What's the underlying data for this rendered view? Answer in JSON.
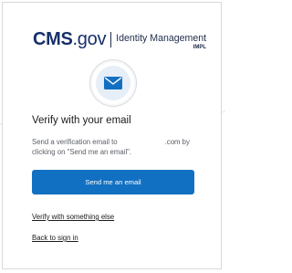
{
  "header": {
    "logo_cms": "CMS",
    "logo_dotgov": ".gov",
    "logo_product": "Identity Management",
    "logo_env": "IMPL"
  },
  "icon": {
    "name": "email-envelope-icon",
    "circle_color": "#e6eef8",
    "envelope_color": "#1270c2"
  },
  "main": {
    "heading": "Verify with your email",
    "description_part1": "Send a verification email to",
    "description_part2": ".com by clicking on \"Send me an email\".",
    "send_button_label": "Send me an email",
    "verify_other_link": "Verify with something else",
    "back_link": "Back to sign in"
  },
  "colors": {
    "brand_navy": "#17306b",
    "primary_button": "#1270c2",
    "text_dark": "#1b1b1b",
    "text_muted": "#5a5f66"
  }
}
